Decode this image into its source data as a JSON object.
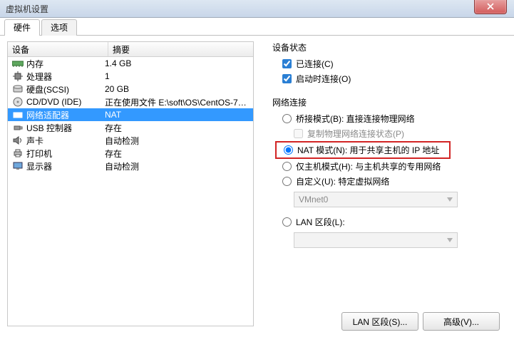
{
  "window": {
    "title": "虚拟机设置"
  },
  "tabs": {
    "hardware": "硬件",
    "options": "选项"
  },
  "devlist": {
    "col_name": "设备",
    "col_summary": "摘要",
    "items": [
      {
        "icon": "memory-icon",
        "name": "内存",
        "summary": "1.4 GB"
      },
      {
        "icon": "cpu-icon",
        "name": "处理器",
        "summary": "1"
      },
      {
        "icon": "disk-icon",
        "name": "硬盘(SCSI)",
        "summary": "20 GB"
      },
      {
        "icon": "cd-icon",
        "name": "CD/DVD (IDE)",
        "summary": "正在使用文件 E:\\soft\\OS\\CentOS-7…"
      },
      {
        "icon": "nic-icon",
        "name": "网络适配器",
        "summary": "NAT"
      },
      {
        "icon": "usb-icon",
        "name": "USB 控制器",
        "summary": "存在"
      },
      {
        "icon": "sound-icon",
        "name": "声卡",
        "summary": "自动检测"
      },
      {
        "icon": "printer-icon",
        "name": "打印机",
        "summary": "存在"
      },
      {
        "icon": "display-icon",
        "name": "显示器",
        "summary": "自动检测"
      }
    ],
    "selected_index": 4
  },
  "status": {
    "group": "设备状态",
    "connected": "已连接(C)",
    "connect_at_poweron": "启动时连接(O)"
  },
  "netconn": {
    "group": "网络连接",
    "bridged": "桥接模式(B): 直接连接物理网络",
    "replicate": "复制物理网络连接状态(P)",
    "nat": "NAT 模式(N): 用于共享主机的 IP 地址",
    "hostonly": "仅主机模式(H): 与主机共享的专用网络",
    "custom": "自定义(U): 特定虚拟网络",
    "custom_value": "VMnet0",
    "lanseg": "LAN 区段(L):",
    "lanseg_value": ""
  },
  "buttons": {
    "lan_segments": "LAN 区段(S)...",
    "advanced": "高级(V)..."
  }
}
